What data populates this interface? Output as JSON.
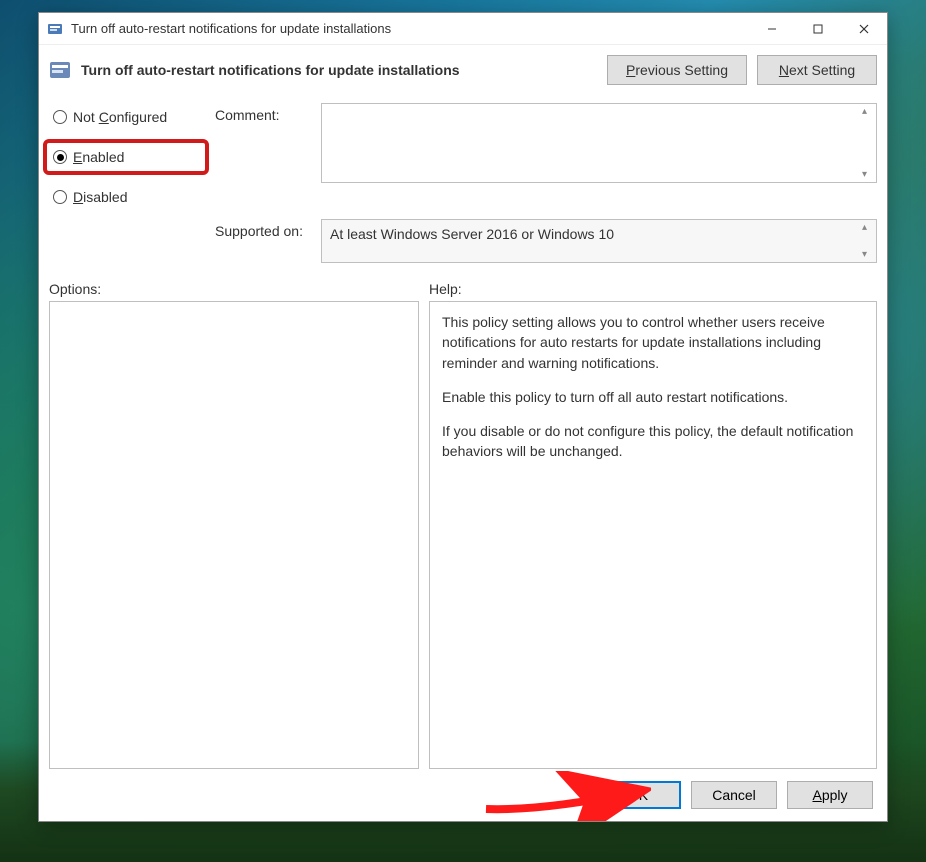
{
  "window": {
    "title": "Turn off auto-restart notifications for update installations"
  },
  "header": {
    "title": "Turn off auto-restart notifications for update installations",
    "previous_label": "Previous Setting",
    "next_label": "Next Setting"
  },
  "radios": {
    "not_configured": "Not Configured",
    "enabled": "Enabled",
    "disabled": "Disabled",
    "selected": "enabled"
  },
  "fields": {
    "comment_label": "Comment:",
    "comment_value": "",
    "supported_label": "Supported on:",
    "supported_value": "At least Windows Server 2016 or Windows 10"
  },
  "lower": {
    "options_label": "Options:",
    "help_label": "Help:",
    "help_paragraphs": [
      "This policy setting allows you to control whether users receive notifications for auto restarts for update installations including reminder and warning notifications.",
      "Enable this policy to turn off all auto restart notifications.",
      "If you disable or do not configure this policy, the default notification behaviors will be unchanged."
    ]
  },
  "footer": {
    "ok": "OK",
    "cancel": "Cancel",
    "apply": "Apply"
  }
}
